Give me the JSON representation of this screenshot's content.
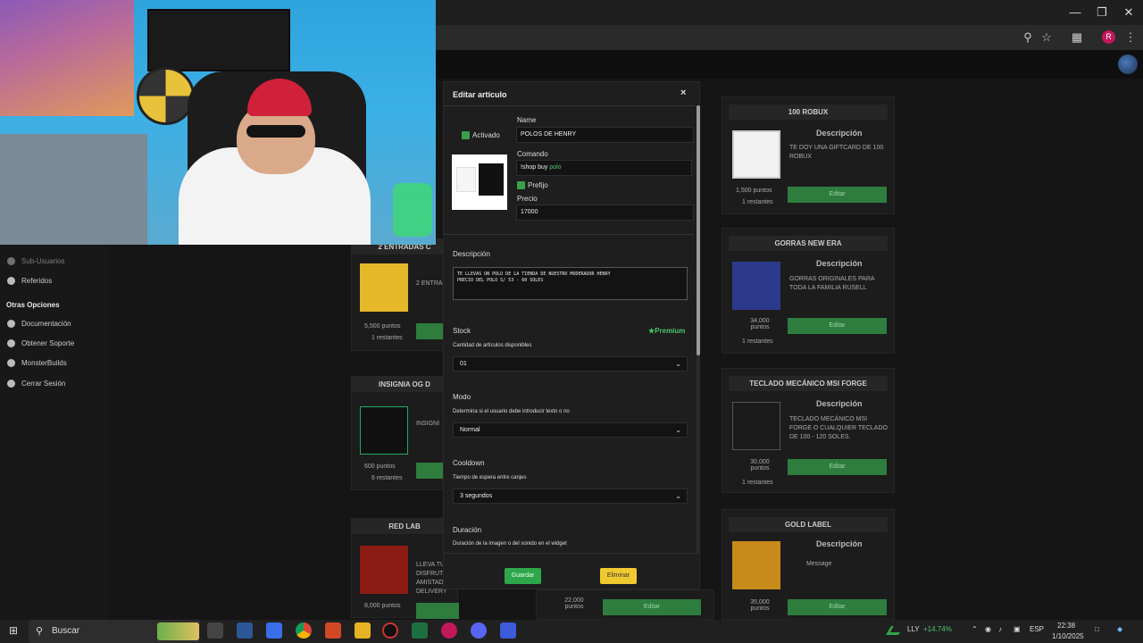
{
  "browser": {
    "window_controls": {
      "minimize": "—",
      "maximize": "❐",
      "close": "✕"
    },
    "toolbar_icons": [
      "zoom-icon",
      "star-icon",
      "extensions-icon",
      "menu-icon"
    ],
    "profile_initial": "R"
  },
  "sidebar": {
    "items_top": [
      {
        "label": "Sub-Usuarios",
        "icon": "users-icon"
      },
      {
        "label": "Referidos",
        "icon": "referrals-icon"
      }
    ],
    "section_title": "Otras Opciones",
    "items": [
      {
        "label": "Documentación",
        "icon": "docs-icon"
      },
      {
        "label": "Obtener Soporte",
        "icon": "support-icon"
      },
      {
        "label": "MonsterBuilds",
        "icon": "builds-icon"
      },
      {
        "label": "Cerrar Sesión",
        "icon": "logout-icon"
      }
    ]
  },
  "cards_left": [
    {
      "title": "2 ENTRADAS C",
      "desc": "2 ENTRA",
      "points": "5,500 puntos",
      "remaining": "1 restantes"
    },
    {
      "title": "INSIGNIA OG D",
      "desc": "INSIGNI",
      "points": "600 puntos",
      "remaining": "6 restantes"
    },
    {
      "title": "RED LAB",
      "desc": "LLEVA TU DISFRUTA AMISTAD DELIVERY",
      "points": "8,000 puntos",
      "remaining": "3 restantes"
    }
  ],
  "card_mid_bottom": {
    "points": "22,000 puntos",
    "edit": "Editar"
  },
  "cards_right": [
    {
      "title": "100 ROBUX",
      "desc_heading": "Descripción",
      "desc": "TE DOY UNA GIFTCARD DE 100 ROBUX",
      "points": "1,500 puntos",
      "remaining": "1 restantes",
      "edit": "Editar"
    },
    {
      "title": "GORRAS NEW ERA",
      "desc_heading": "Descripción",
      "desc": "GORRAS ORIGINALES PARA TODA LA FAMILIA RUSELL",
      "points": "34,000 puntos",
      "remaining": "1 restantes",
      "edit": "Editar"
    },
    {
      "title": "TECLADO MECÁNICO MSI FORGE",
      "desc_heading": "Descripción",
      "desc": "TECLADO MECÁNICO MSI FORGE O CUALQUIER TECLADO DE 100 - 120 SOLES.",
      "points": "30,000 puntos",
      "remaining": "1 restantes",
      "edit": "Editar"
    },
    {
      "title": "GOLD LABEL",
      "desc_heading": "Descripción",
      "desc": "Message",
      "points": "35,000 puntos",
      "remaining": "",
      "edit": "Editar"
    }
  ],
  "modal": {
    "title": "Editar artículo",
    "close": "×",
    "activated_label": "Activado",
    "name_label": "Name",
    "name_value": "POLOS DE HENRY",
    "command_label": "Comando",
    "command_prefix": "!shop buy ",
    "command_value": "polo",
    "prefix_label": "Prefijo",
    "price_label": "Precio",
    "price_value": "17000",
    "description_label": "Descripción",
    "description_line1": "TE LLEVAS UN POLO DE LA TIENDA DE NUESTRO MODERADOR HENRY",
    "description_line2": "PRECIO DEL POLO S/ 53 - 60 SOLES",
    "stock_label": "Stock",
    "premium_label": "Premium",
    "stock_help": "Cantidad de artículos disponibles",
    "stock_value": "01",
    "mode_label": "Modo",
    "mode_help": "Determina si el usuario debe introducir texto o no",
    "mode_value": "Normal",
    "cooldown_label": "Cooldown",
    "cooldown_help": "Tiempo de espera entre canjes",
    "cooldown_value": "3 segundos",
    "duration_label": "Duración",
    "duration_help": "Duración de la imagen o del sonido en el widget",
    "save_button": "Guardar",
    "delete_button": "Eliminar"
  },
  "taskbar": {
    "search_placeholder": "Buscar",
    "stock_ticker": "LLY",
    "stock_change": "+14.74%",
    "language": "ESP",
    "time": "22:38",
    "date": "1/10/2025"
  },
  "colors": {
    "accent_green": "#2e7d3e",
    "checkbox_green": "#3aa14a",
    "delete_yellow": "#f0c930",
    "premium_green": "#4ec46a"
  }
}
